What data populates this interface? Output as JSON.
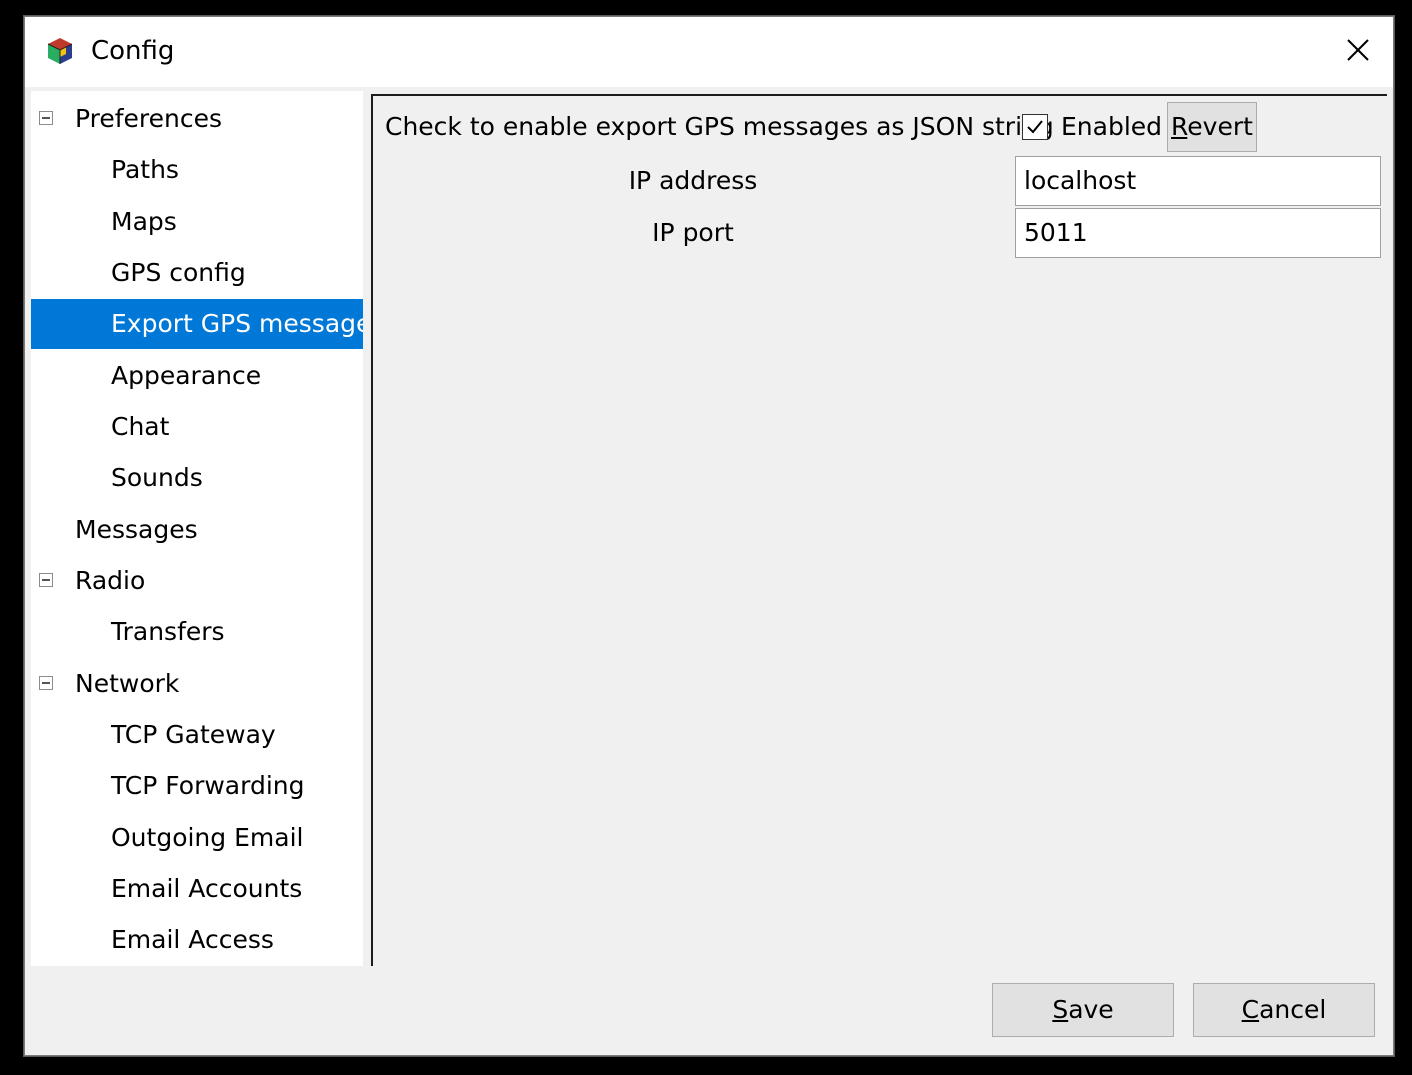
{
  "window": {
    "title": "Config",
    "icons": {
      "app": "app-cube-icon",
      "close": "close-icon"
    }
  },
  "tree": {
    "items": [
      {
        "label": "Preferences",
        "level": 0,
        "expandable": true,
        "expander_icon": "collapse-icon"
      },
      {
        "label": "Paths",
        "level": 1
      },
      {
        "label": "Maps",
        "level": 1
      },
      {
        "label": "GPS config",
        "level": 1
      },
      {
        "label": "Export GPS messages",
        "level": 1,
        "selected": true
      },
      {
        "label": "Appearance",
        "level": 1
      },
      {
        "label": "Chat",
        "level": 1
      },
      {
        "label": "Sounds",
        "level": 1
      },
      {
        "label": "Messages",
        "level": 0
      },
      {
        "label": "Radio",
        "level": 0,
        "expandable": true,
        "expander_icon": "collapse-icon"
      },
      {
        "label": "Transfers",
        "level": 1
      },
      {
        "label": "Network",
        "level": 0,
        "expandable": true,
        "expander_icon": "collapse-icon"
      },
      {
        "label": "TCP Gateway",
        "level": 1
      },
      {
        "label": "TCP Forwarding",
        "level": 1
      },
      {
        "label": "Outgoing Email",
        "level": 1
      },
      {
        "label": "Email Accounts",
        "level": 1
      },
      {
        "label": "Email Access",
        "level": 1
      }
    ]
  },
  "panel": {
    "enable_text": "Check to enable export GPS messages as JSON string",
    "enabled_label": "Enabled",
    "enabled_checked": true,
    "revert": {
      "mnemonic": "R",
      "rest": "evert"
    },
    "ip_address": {
      "label": "IP address",
      "value": "localhost"
    },
    "ip_port": {
      "label": "IP port",
      "value": "5011"
    }
  },
  "footer": {
    "save": {
      "mnemonic": "S",
      "rest": "ave"
    },
    "cancel": {
      "mnemonic": "C",
      "rest": "ancel"
    }
  },
  "colors": {
    "selection": "#0078d7",
    "window_bg": "#f0f0f0"
  }
}
